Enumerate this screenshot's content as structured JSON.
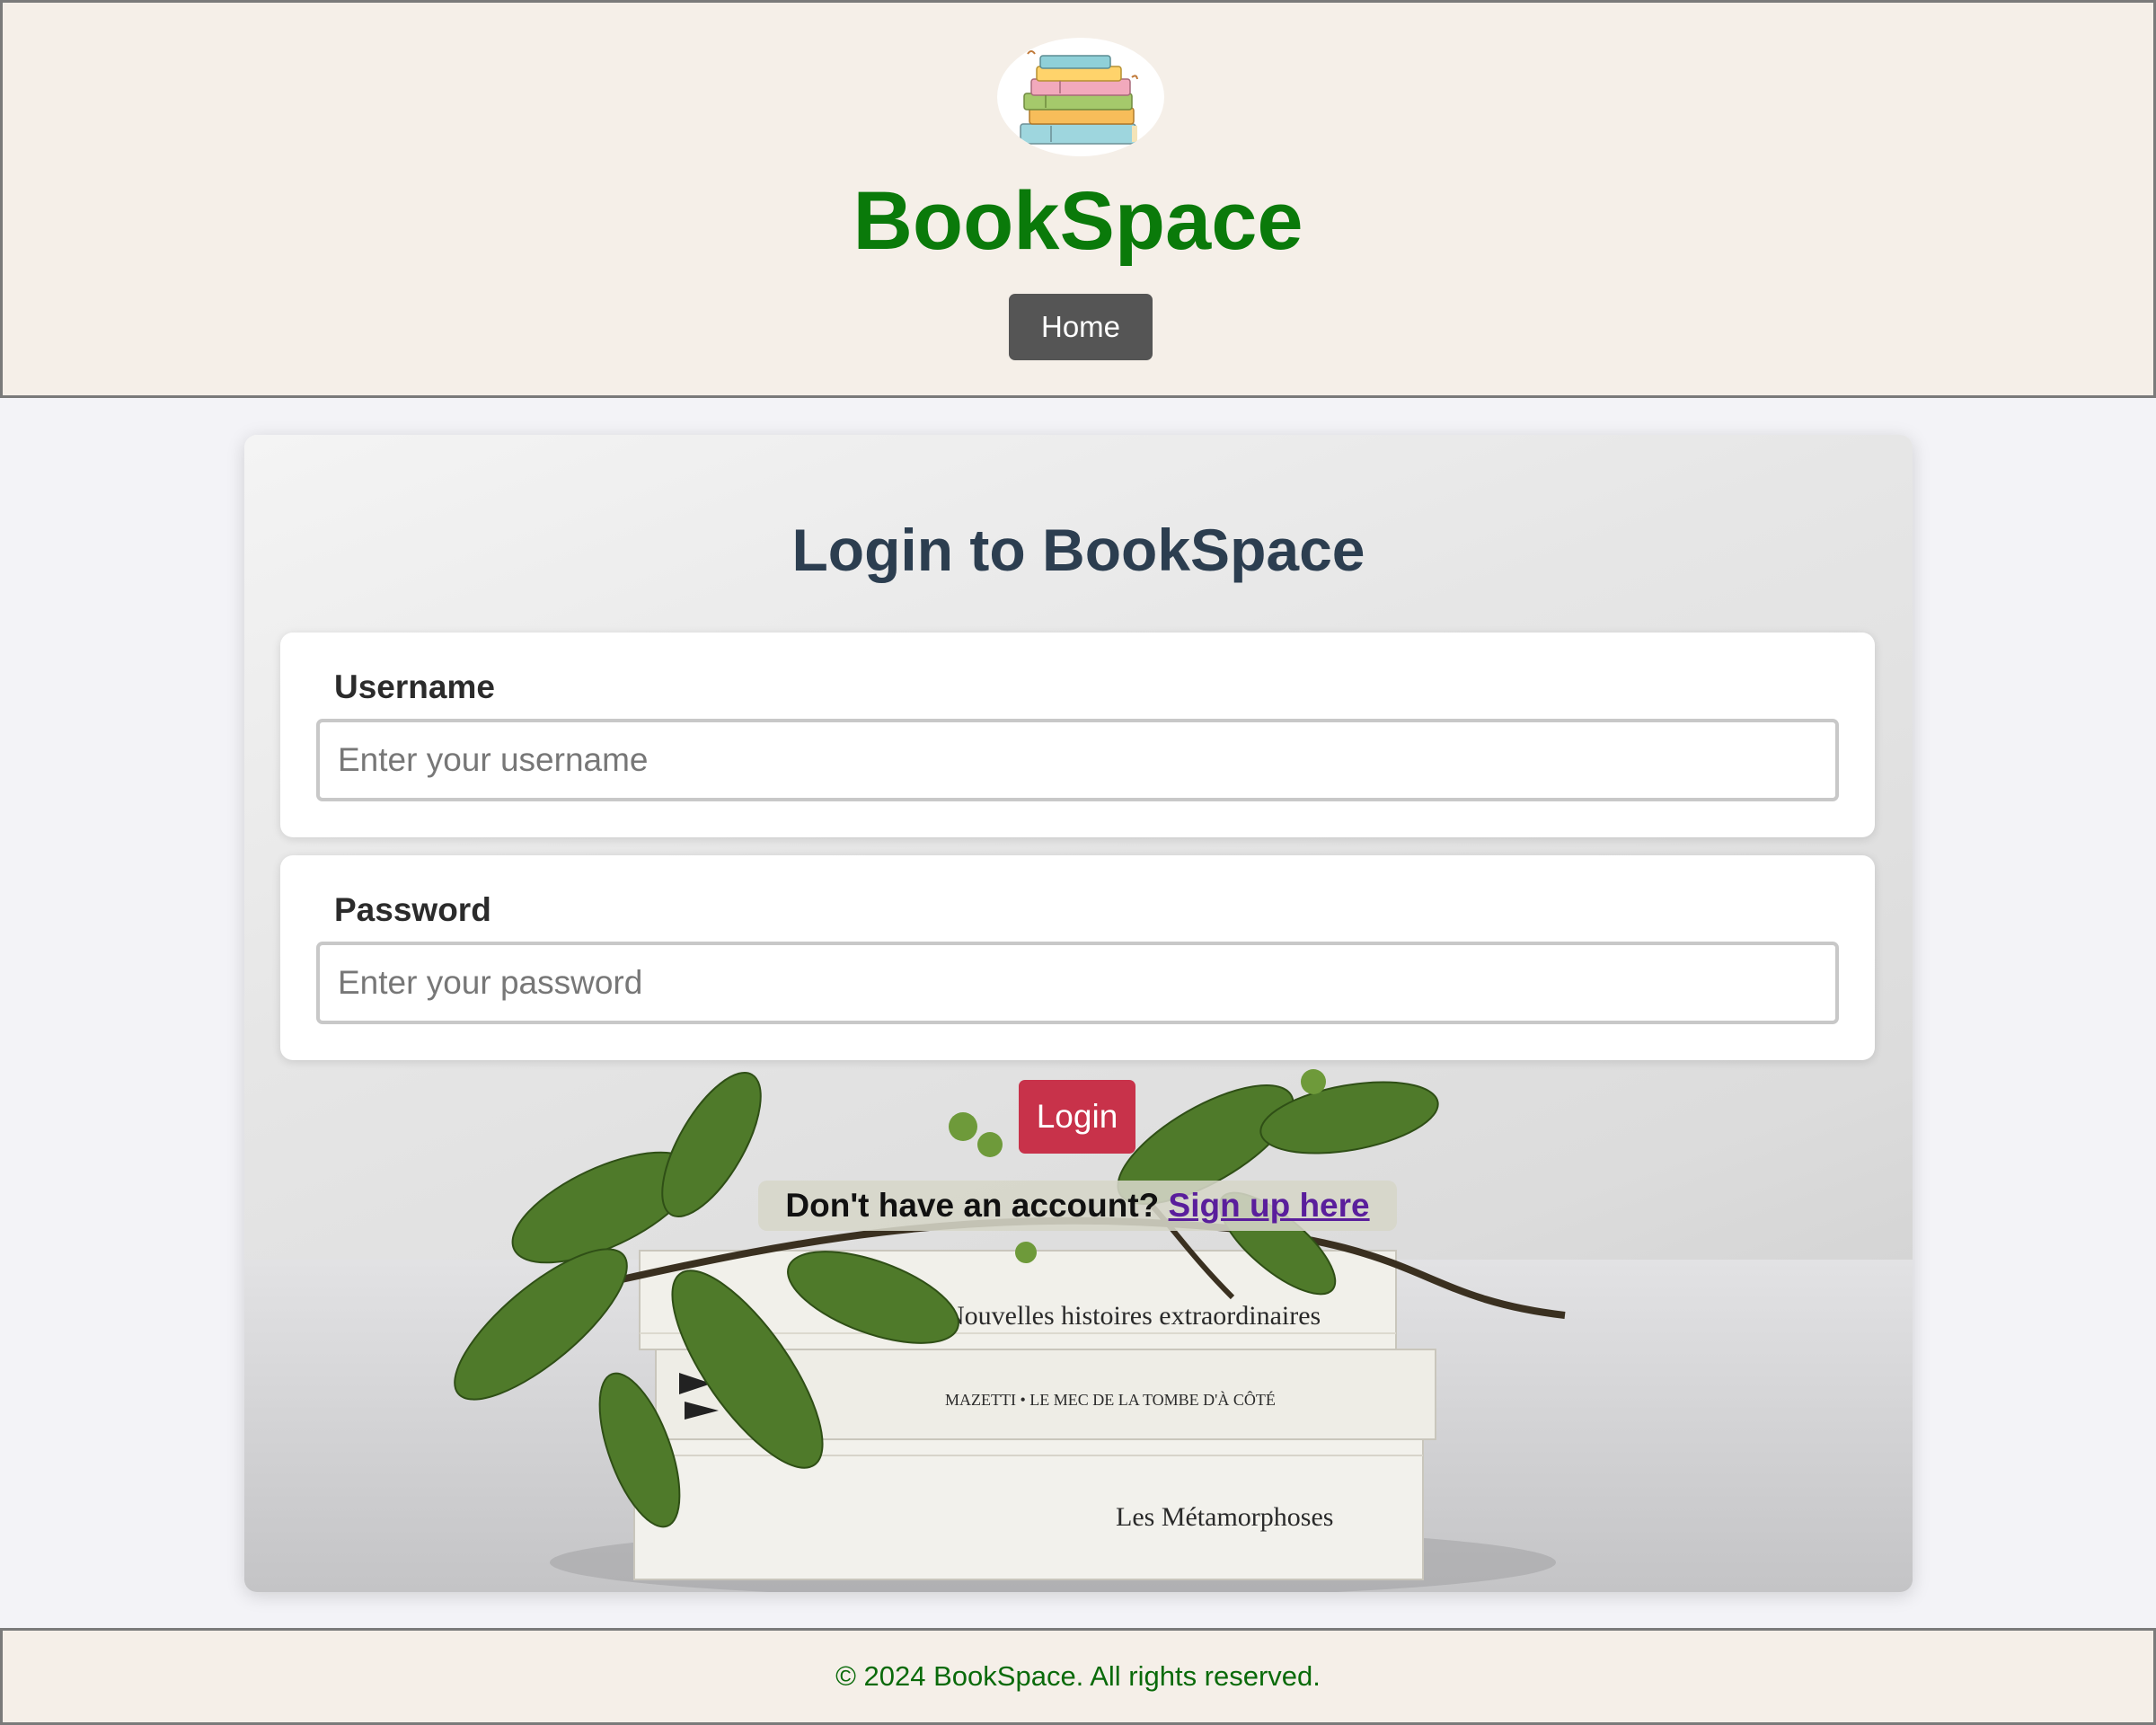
{
  "header": {
    "title": "BookSpace",
    "logo_icon": "stacked-books-icon",
    "nav": {
      "home_label": "Home"
    }
  },
  "login": {
    "title": "Login to BookSpace",
    "username": {
      "label": "Username",
      "placeholder": "Enter your username",
      "value": ""
    },
    "password": {
      "label": "Password",
      "placeholder": "Enter your password",
      "value": ""
    },
    "submit_label": "Login",
    "signup_prompt": "Don't have an account?",
    "signup_link": "Sign up here",
    "background_book_titles": [
      "Nouvelles histoires extraordinaires",
      "MAZETTI • LE MEC DE LA TOMBE D'À CÔTÉ",
      "Les Métamorphoses"
    ]
  },
  "footer": {
    "text": "© 2024 BookSpace. All rights reserved."
  },
  "colors": {
    "brand_green": "#0a7a0a",
    "header_bg": "#f5efe8",
    "home_button": "#555555",
    "login_button": "#c8324a",
    "title_text": "#2c3e50",
    "link": "#5a1e9c"
  }
}
